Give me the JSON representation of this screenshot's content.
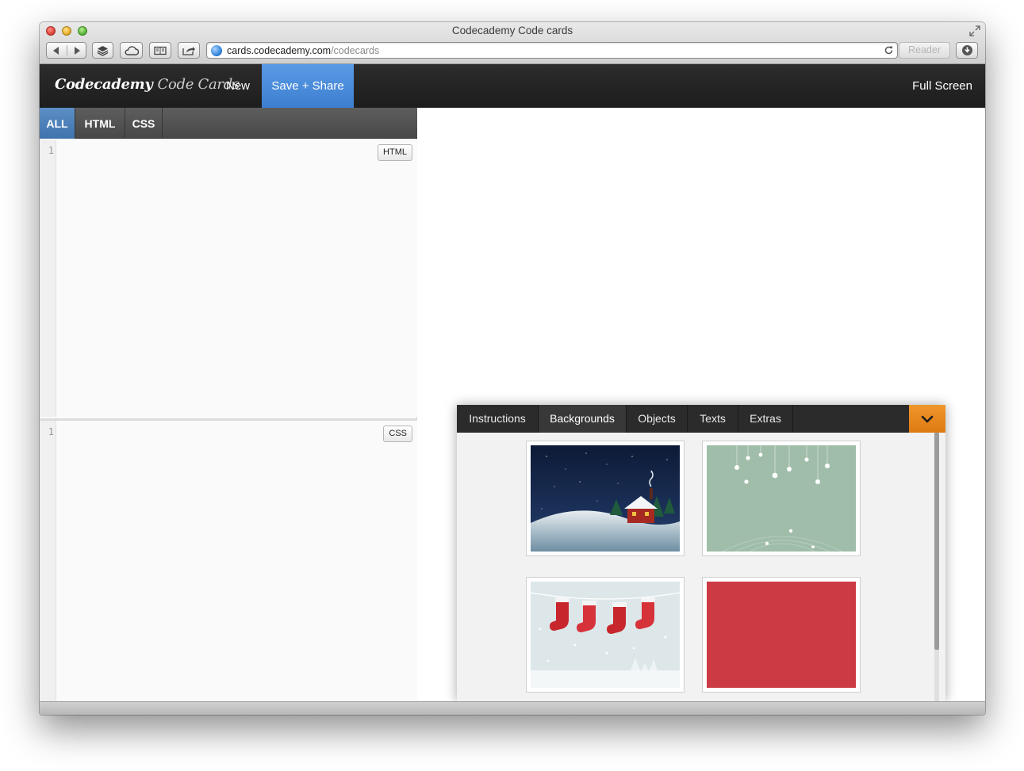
{
  "window": {
    "title": "Codecademy Code cards"
  },
  "toolbar": {
    "url_host": "cards.codecademy.com",
    "url_path": "/codecards",
    "reader_label": "Reader"
  },
  "header": {
    "logo_main": "Codecademy",
    "logo_sub": "Code Cards",
    "nav_new": "New",
    "nav_save_share": "Save + Share",
    "nav_full_screen": "Full Screen"
  },
  "editor": {
    "tabs": [
      {
        "label": "ALL",
        "active": true
      },
      {
        "label": "HTML",
        "active": false
      },
      {
        "label": "CSS",
        "active": false
      }
    ],
    "html_pane": {
      "line_number": "1",
      "badge": "HTML"
    },
    "css_pane": {
      "line_number": "1",
      "badge": "CSS"
    }
  },
  "panel": {
    "tabs": [
      {
        "label": "Instructions",
        "active": false
      },
      {
        "label": "Backgrounds",
        "active": true
      },
      {
        "label": "Objects",
        "active": false
      },
      {
        "label": "Texts",
        "active": false
      },
      {
        "label": "Extras",
        "active": false
      }
    ],
    "toggle_icon": "chevron-down-icon",
    "toggle_color": "#e8841c",
    "backgrounds": [
      {
        "name": "night-cabin-background",
        "color": "#1b2f52"
      },
      {
        "name": "hanging-stars-background",
        "color": "#9fbda9"
      },
      {
        "name": "stockings-background",
        "color": "#dfe8ea"
      },
      {
        "name": "plain-red-background",
        "color": "#cc3a43"
      }
    ]
  },
  "colors": {
    "active_tab": "#4a7fb9",
    "save_button": "#4a8ad9",
    "header_bg": "#242424"
  }
}
